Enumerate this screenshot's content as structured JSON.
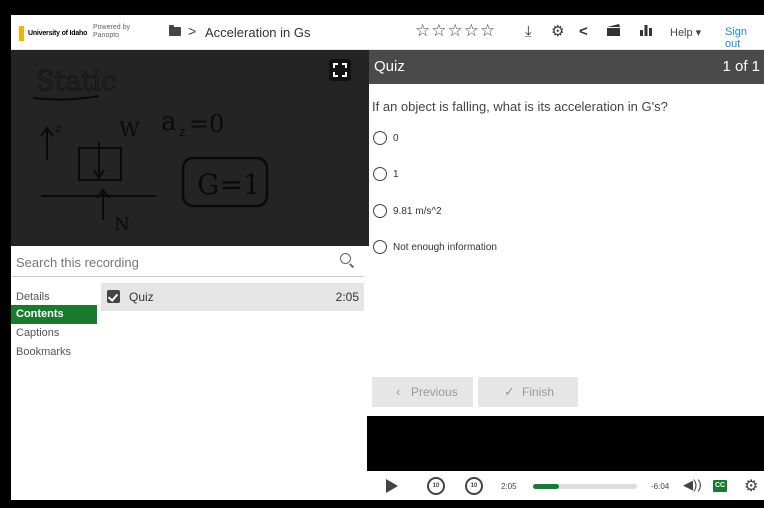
{
  "header": {
    "logo_text": "University of Idaho",
    "powered_line1": "Powered by",
    "powered_line2": "Panopto",
    "breadcrumb_sep": ">",
    "title": "Acceleration in Gs",
    "stars": "☆☆☆☆☆",
    "help_label": "Help ▾",
    "signout_label": "Sign out"
  },
  "video": {
    "whiteboard_static": "Static",
    "whiteboard_az": "a",
    "whiteboard_az_sub": "z",
    "whiteboard_eq": "=0",
    "whiteboard_g1": "G=1",
    "whiteboard_w": "W",
    "whiteboard_n": "N",
    "whiteboard_z": "z"
  },
  "search": {
    "placeholder": "Search this recording"
  },
  "sidebar": {
    "tabs": [
      {
        "label": "Details"
      },
      {
        "label": "Contents"
      },
      {
        "label": "Captions"
      },
      {
        "label": "Bookmarks"
      }
    ]
  },
  "contents": {
    "items": [
      {
        "title": "Quiz",
        "time": "2:05"
      }
    ]
  },
  "quiz": {
    "title": "Quiz",
    "count": "1 of 1",
    "question": "If an object is falling, what is its acceleration in G's?",
    "options": [
      {
        "label": "0"
      },
      {
        "label": "1"
      },
      {
        "label": "9.81 m/s^2"
      },
      {
        "label": "Not enough information"
      }
    ],
    "previous_label": "Previous",
    "finish_label": "Finish"
  },
  "player": {
    "current_time": "2:05",
    "remaining_time": "-6:04",
    "progress_fraction": 0.25,
    "skip_back": "10",
    "skip_fwd": "10",
    "cc_label": "CC"
  },
  "colors": {
    "accent": "#1a7a2f",
    "link": "#1a8ad8",
    "header_dark": "#4a4a4a"
  }
}
